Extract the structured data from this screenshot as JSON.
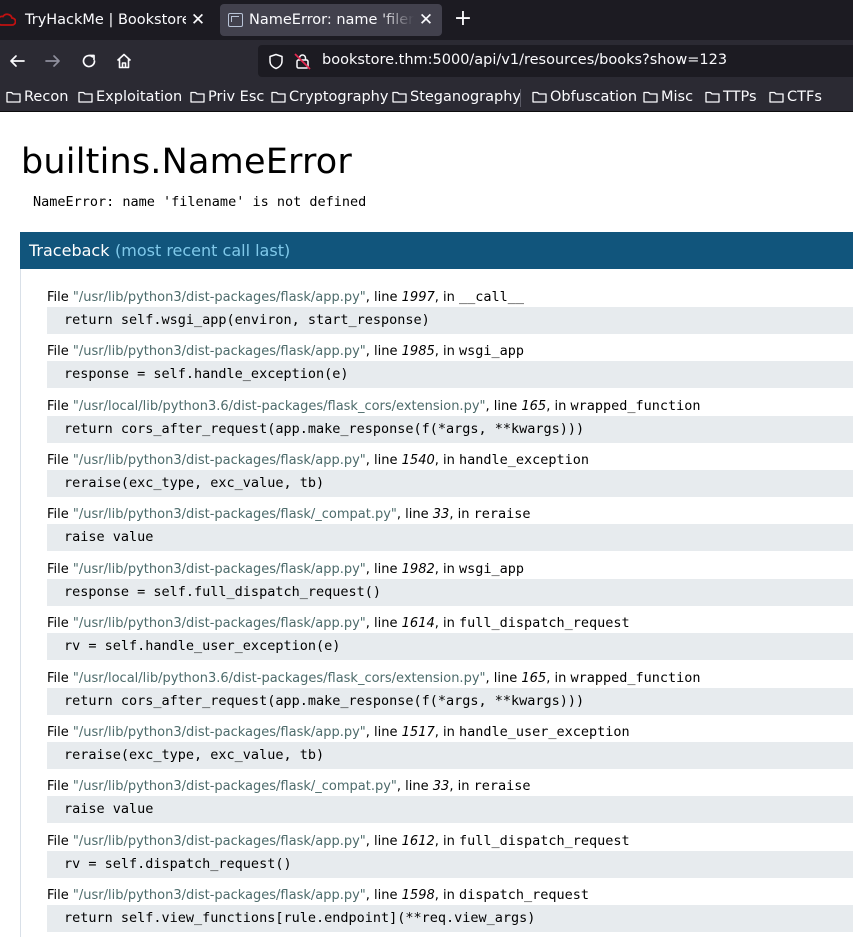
{
  "tabs": [
    {
      "title": "TryHackMe | Bookstore",
      "icon": "tryhackme-cloud-icon",
      "active": false
    },
    {
      "title": "NameError: name 'filename' is not defined",
      "icon": "page-icon",
      "active": true
    }
  ],
  "tab_close_glyph": "✕",
  "new_tab_glyph": "+",
  "url": "bookstore.thm:5000/api/v1/resources/books?show=123",
  "bookmarks": [
    "Recon",
    "Exploitation",
    "Priv Esc",
    "Cryptography",
    "Steganography",
    "Obfuscation",
    "Misc",
    "TTPs",
    "CTFs"
  ],
  "page": {
    "title": "builtins.NameError",
    "error_message": "NameError: name 'filename' is not defined",
    "traceback_title": "Traceback",
    "traceback_subtitle": "(most recent call last)"
  },
  "frame_labels": {
    "file": "File ",
    "line": ", line ",
    "in": ", in "
  },
  "frames": [
    {
      "path": "\"/usr/lib/python3/dist-packages/flask/app.py\"",
      "line": "1997",
      "func": "__call__",
      "code": "return self.wsgi_app(environ, start_response)"
    },
    {
      "path": "\"/usr/lib/python3/dist-packages/flask/app.py\"",
      "line": "1985",
      "func": "wsgi_app",
      "code": "response = self.handle_exception(e)"
    },
    {
      "path": "\"/usr/local/lib/python3.6/dist-packages/flask_cors/extension.py\"",
      "line": "165",
      "func": "wrapped_function",
      "code": "return cors_after_request(app.make_response(f(*args, **kwargs)))"
    },
    {
      "path": "\"/usr/lib/python3/dist-packages/flask/app.py\"",
      "line": "1540",
      "func": "handle_exception",
      "code": "reraise(exc_type, exc_value, tb)"
    },
    {
      "path": "\"/usr/lib/python3/dist-packages/flask/_compat.py\"",
      "line": "33",
      "func": "reraise",
      "code": "raise value"
    },
    {
      "path": "\"/usr/lib/python3/dist-packages/flask/app.py\"",
      "line": "1982",
      "func": "wsgi_app",
      "code": "response = self.full_dispatch_request()"
    },
    {
      "path": "\"/usr/lib/python3/dist-packages/flask/app.py\"",
      "line": "1614",
      "func": "full_dispatch_request",
      "code": "rv = self.handle_user_exception(e)"
    },
    {
      "path": "\"/usr/local/lib/python3.6/dist-packages/flask_cors/extension.py\"",
      "line": "165",
      "func": "wrapped_function",
      "code": "return cors_after_request(app.make_response(f(*args, **kwargs)))"
    },
    {
      "path": "\"/usr/lib/python3/dist-packages/flask/app.py\"",
      "line": "1517",
      "func": "handle_user_exception",
      "code": "reraise(exc_type, exc_value, tb)"
    },
    {
      "path": "\"/usr/lib/python3/dist-packages/flask/_compat.py\"",
      "line": "33",
      "func": "reraise",
      "code": "raise value"
    },
    {
      "path": "\"/usr/lib/python3/dist-packages/flask/app.py\"",
      "line": "1612",
      "func": "full_dispatch_request",
      "code": "rv = self.dispatch_request()"
    },
    {
      "path": "\"/usr/lib/python3/dist-packages/flask/app.py\"",
      "line": "1598",
      "func": "dispatch_request",
      "code": "return self.view_functions[rule.endpoint](**req.view_args)"
    }
  ],
  "colors": {
    "tab_strip": "#1c1b22",
    "toolbar": "#2b2a33",
    "traceback_header": "#11557c",
    "traceback_subtitle": "#80c9ea",
    "code_background": "#e7ebee"
  }
}
